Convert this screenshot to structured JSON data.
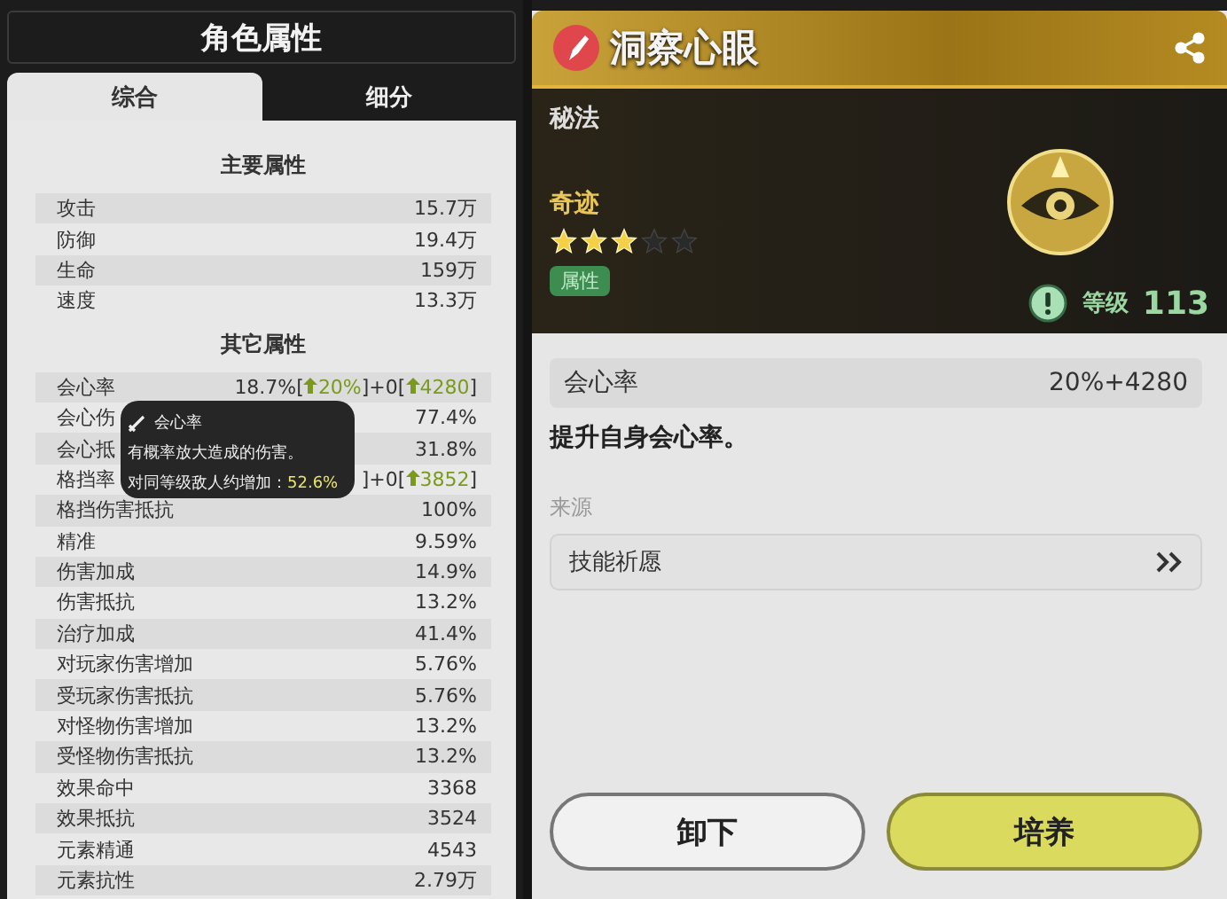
{
  "left_panel": {
    "title": "角色属性",
    "tabs": [
      {
        "label": "综合",
        "selected": true
      },
      {
        "label": "细分",
        "selected": false
      }
    ],
    "main_section": {
      "title": "主要属性",
      "rows": [
        {
          "label": "攻击",
          "value": "15.7万"
        },
        {
          "label": "防御",
          "value": "19.4万"
        },
        {
          "label": "生命",
          "value": "159万"
        },
        {
          "label": "速度",
          "value": "13.3万"
        }
      ]
    },
    "other_section": {
      "title": "其它属性",
      "rows": [
        {
          "label": "会心率",
          "parts": [
            {
              "text": "18.7%[",
              "kind": "plain"
            },
            {
              "text": "20%",
              "kind": "up"
            },
            {
              "text": "]+0[",
              "kind": "plain"
            },
            {
              "text": "4280",
              "kind": "up"
            },
            {
              "text": "]",
              "kind": "plain"
            }
          ]
        },
        {
          "label": "会心伤",
          "value": "77.4%"
        },
        {
          "label": "会心抵",
          "value": "31.8%"
        },
        {
          "label": "格挡率",
          "parts": [
            {
              "text": "]+0[",
              "kind": "plain"
            },
            {
              "text": "3852",
              "kind": "up"
            },
            {
              "text": "]",
              "kind": "plain"
            }
          ]
        },
        {
          "label": "格挡伤害抵抗",
          "value": "100%"
        },
        {
          "label": "精准",
          "value": "9.59%"
        },
        {
          "label": "伤害加成",
          "value": "14.9%"
        },
        {
          "label": "伤害抵抗",
          "value": "13.2%"
        },
        {
          "label": "治疗加成",
          "value": "41.4%"
        },
        {
          "label": "对玩家伤害增加",
          "value": "5.76%"
        },
        {
          "label": "受玩家伤害抵抗",
          "value": "5.76%"
        },
        {
          "label": "对怪物伤害增加",
          "value": "13.2%"
        },
        {
          "label": "受怪物伤害抵抗",
          "value": "13.2%"
        },
        {
          "label": "效果命中",
          "value": "3368"
        },
        {
          "label": "效果抵抗",
          "value": "3524"
        },
        {
          "label": "元素精通",
          "value": "4543"
        },
        {
          "label": "元素抗性",
          "value": "2.79万"
        }
      ]
    },
    "tooltip": {
      "title": "会心率",
      "description": "有概率放大造成的伤害。",
      "bonus_label": "对同等级敌人约增加：",
      "bonus_value": "52.6%"
    }
  },
  "right_panel": {
    "title": "洞察心眼",
    "category": "秘法",
    "rarity": "奇迹",
    "stars": 3,
    "tag": "属性",
    "level_label": "等级",
    "level": "113",
    "stat": {
      "label": "会心率",
      "value": "20%+4280"
    },
    "description": "提升自身会心率。",
    "source_title": "来源",
    "source": "技能祈愿",
    "buttons": [
      {
        "label": "卸下",
        "kind": "secondary"
      },
      {
        "label": "培养",
        "kind": "primary"
      }
    ]
  }
}
